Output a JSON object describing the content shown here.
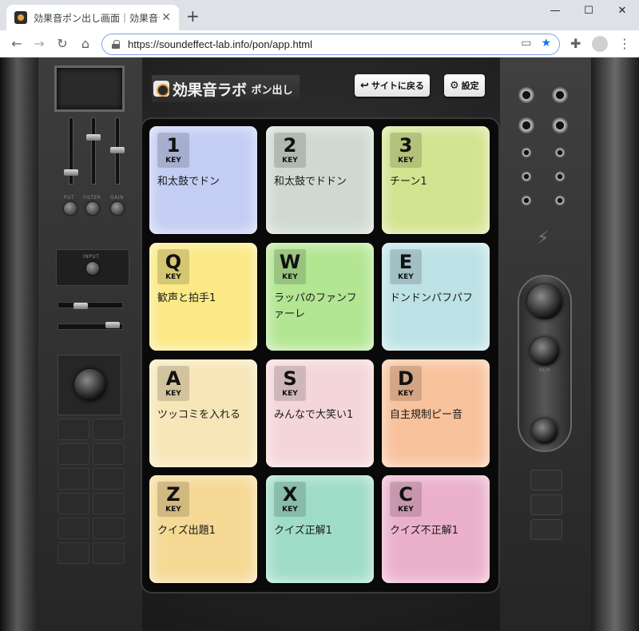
{
  "browser": {
    "tab_title": "効果音ポン出し画面｜効果音ラボ",
    "new_tab": "+",
    "url": "https://soundeffect-lab.info/pon/app.html",
    "window": {
      "minimize": "—",
      "maximize": "☐",
      "close": "✕"
    }
  },
  "app": {
    "logo_main": "効果音ラボ",
    "logo_sub": "ポン出し",
    "back_button": "サイトに戻る",
    "settings_button": "設定",
    "panel_labels": {
      "put": "PUT",
      "filter": "FILTER",
      "gain": "GAIN",
      "input": "INPUT",
      "sch": "SCH"
    }
  },
  "pads": [
    {
      "key": "1",
      "key_word": "KEY",
      "label": "和太鼓でドン",
      "color": "#c4cdf3"
    },
    {
      "key": "2",
      "key_word": "KEY",
      "label": "和太鼓でドドン",
      "color": "#cfd9d2"
    },
    {
      "key": "3",
      "key_word": "KEY",
      "label": "チーン1",
      "color": "#d3e38f"
    },
    {
      "key": "Q",
      "key_word": "KEY",
      "label": "歓声と拍手1",
      "color": "#fbe986"
    },
    {
      "key": "W",
      "key_word": "KEY",
      "label": "ラッパのファンファーレ",
      "color": "#b3e693"
    },
    {
      "key": "E",
      "key_word": "KEY",
      "label": "ドンドンパフパフ",
      "color": "#bde2e6"
    },
    {
      "key": "A",
      "key_word": "KEY",
      "label": "ツッコミを入れる",
      "color": "#f7e6b8"
    },
    {
      "key": "S",
      "key_word": "KEY",
      "label": "みんなで大笑い1",
      "color": "#f4d6da"
    },
    {
      "key": "D",
      "key_word": "KEY",
      "label": "自主規制ピー音",
      "color": "#f8c29d"
    },
    {
      "key": "Z",
      "key_word": "KEY",
      "label": "クイズ出題1",
      "color": "#f5d995"
    },
    {
      "key": "X",
      "key_word": "KEY",
      "label": "クイズ正解1",
      "color": "#9fdcc8"
    },
    {
      "key": "C",
      "key_word": "KEY",
      "label": "クイズ不正解1",
      "color": "#ebb1cb"
    }
  ]
}
